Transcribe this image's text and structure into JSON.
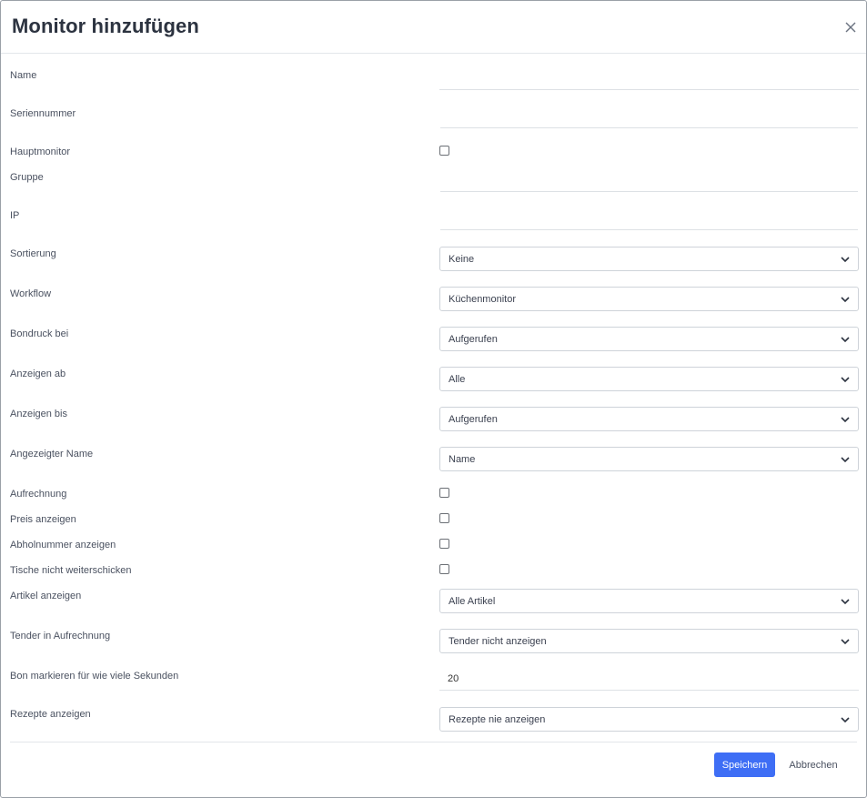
{
  "dialog": {
    "title": "Monitor hinzufügen",
    "close_icon": "close-icon"
  },
  "fields": {
    "name": {
      "label": "Name",
      "value": ""
    },
    "seriennummer": {
      "label": "Seriennummer",
      "value": ""
    },
    "hauptmonitor": {
      "label": "Hauptmonitor",
      "checked": false
    },
    "gruppe": {
      "label": "Gruppe",
      "value": ""
    },
    "ip": {
      "label": "IP",
      "value": ""
    },
    "sortierung": {
      "label": "Sortierung",
      "selected": "Keine"
    },
    "workflow": {
      "label": "Workflow",
      "selected": "Küchenmonitor"
    },
    "bondruck_bei": {
      "label": "Bondruck bei",
      "selected": "Aufgerufen"
    },
    "anzeigen_ab": {
      "label": "Anzeigen ab",
      "selected": "Alle"
    },
    "anzeigen_bis": {
      "label": "Anzeigen bis",
      "selected": "Aufgerufen"
    },
    "angezeigter_name": {
      "label": "Angezeigter Name",
      "selected": "Name"
    },
    "aufrechnung": {
      "label": "Aufrechnung",
      "checked": false
    },
    "preis_anzeigen": {
      "label": "Preis anzeigen",
      "checked": false
    },
    "abholnummer_anzeigen": {
      "label": "Abholnummer anzeigen",
      "checked": false
    },
    "tische_nicht_weiterschicken": {
      "label": "Tische nicht weiterschicken",
      "checked": false
    },
    "artikel_anzeigen": {
      "label": "Artikel anzeigen",
      "selected": "Alle Artikel"
    },
    "tender_in_aufrechnung": {
      "label": "Tender in Aufrechnung",
      "selected": "Tender nicht anzeigen"
    },
    "bon_markieren": {
      "label": "Bon markieren für wie viele Sekunden",
      "value": "20"
    },
    "rezepte_anzeigen": {
      "label": "Rezepte anzeigen",
      "selected": "Rezepte nie anzeigen"
    }
  },
  "footer": {
    "save_label": "Speichern",
    "cancel_label": "Abbrechen"
  },
  "colors": {
    "primary": "#3e6ef5",
    "border": "#ced3d9",
    "text": "#3a3f4b"
  }
}
